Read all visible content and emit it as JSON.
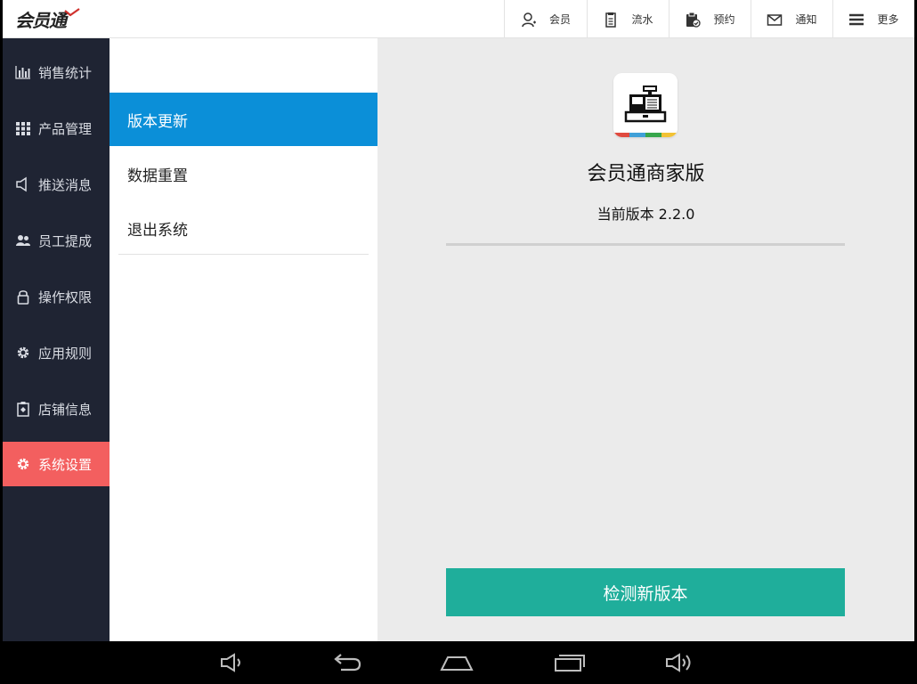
{
  "app": {
    "logo_text": "会员通"
  },
  "topnav": [
    {
      "label": "会员",
      "icon": "member-icon"
    },
    {
      "label": "流水",
      "icon": "ledger-icon"
    },
    {
      "label": "预约",
      "icon": "clipboard-check-icon"
    },
    {
      "label": "通知",
      "icon": "mail-icon"
    },
    {
      "label": "更多",
      "icon": "menu-icon"
    }
  ],
  "sidebar": {
    "items": [
      {
        "label": "销售统计",
        "icon": "bar-chart-icon",
        "active": false
      },
      {
        "label": "产品管理",
        "icon": "grid-icon",
        "active": false
      },
      {
        "label": "推送消息",
        "icon": "speaker-icon",
        "active": false
      },
      {
        "label": "员工提成",
        "icon": "users-icon",
        "active": false
      },
      {
        "label": "操作权限",
        "icon": "lock-icon",
        "active": false
      },
      {
        "label": "应用规则",
        "icon": "gear-icon",
        "active": false
      },
      {
        "label": "店铺信息",
        "icon": "store-icon",
        "active": false
      },
      {
        "label": "系统设置",
        "icon": "settings-icon",
        "active": true
      }
    ]
  },
  "submenu": {
    "items": [
      {
        "label": "版本更新",
        "active": true
      },
      {
        "label": "数据重置",
        "active": false
      },
      {
        "label": "退出系统",
        "active": false
      }
    ]
  },
  "content": {
    "app_icon": "cash-register-icon",
    "app_title": "会员通商家版",
    "version_text": "当前版本 2.2.0",
    "check_button": "检测新版本"
  },
  "android_nav": [
    {
      "icon": "volume-down-icon"
    },
    {
      "icon": "back-icon"
    },
    {
      "icon": "home-icon"
    },
    {
      "icon": "recents-icon"
    },
    {
      "icon": "volume-up-icon"
    }
  ],
  "colors": {
    "sidebar_bg": "#1f2433",
    "sidebar_active": "#f35f5f",
    "submenu_active": "#0b8fd8",
    "button_teal": "#1fae9b",
    "content_bg": "#ebebeb"
  }
}
